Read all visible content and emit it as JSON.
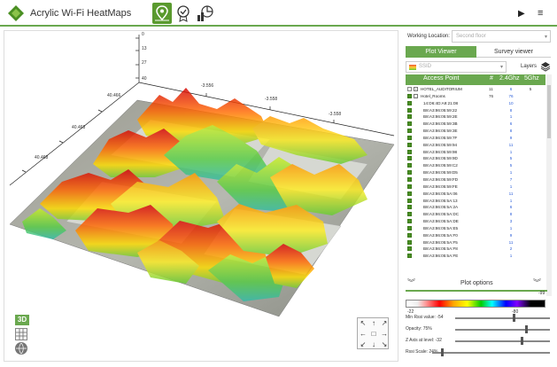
{
  "app": {
    "title": "Acrylic Wi-Fi HeatMaps"
  },
  "toolbar": {
    "modes": [
      "map-pin-icon",
      "badge-icon",
      "chart-icon"
    ],
    "play": "▶",
    "menu": "≡"
  },
  "axes": {
    "z_ticks": [
      "0",
      "13",
      "27",
      "40"
    ],
    "top_ticks": [
      "-3.556",
      "-3.558",
      "-3.558"
    ],
    "left_ticks": [
      "40.466",
      "40.468",
      "40.468"
    ]
  },
  "view_controls": {
    "btn3d": "3D"
  },
  "panel": {
    "working_location_label": "Working Location:",
    "working_location_value": "Second floor",
    "tabs": {
      "plot_viewer": "Plot Viewer",
      "survey_viewer": "Survey viewer"
    },
    "ssid_value": "SSID",
    "layers_label": "Layers",
    "table_headers": {
      "access_point": "Access Point",
      "count": "#",
      "ghz24": "2.4Ghz",
      "ghz5": "5Ghz"
    },
    "rows": [
      {
        "name": "HOTEL_AUDITORIUM",
        "count": "11",
        "ch24": "6",
        "ch5": "5",
        "checked": false,
        "group": true,
        "expander": "+"
      },
      {
        "name": "Hotel_Rooms",
        "count": "76",
        "ch24": "76",
        "ch5": "",
        "checked": true,
        "group": true,
        "expander": "-"
      },
      {
        "name": "14:D6:4D:A9:21:08",
        "count": "",
        "ch24": "10",
        "ch5": "",
        "checked": true
      },
      {
        "name": "B8:A3:86:05:59:22",
        "count": "",
        "ch24": "8",
        "ch5": "",
        "checked": true
      },
      {
        "name": "B8:A3:86:05:59:2E",
        "count": "",
        "ch24": "1",
        "ch5": "",
        "checked": true
      },
      {
        "name": "B8:A3:86:05:59:3B",
        "count": "",
        "ch24": "6",
        "ch5": "",
        "checked": true
      },
      {
        "name": "B8:A3:86:05:59:3E",
        "count": "",
        "ch24": "8",
        "ch5": "",
        "checked": true
      },
      {
        "name": "B8:A3:86:05:59:7F",
        "count": "",
        "ch24": "9",
        "ch5": "",
        "checked": true
      },
      {
        "name": "B8:A3:86:05:59:94",
        "count": "",
        "ch24": "11",
        "ch5": "",
        "checked": true
      },
      {
        "name": "B8:A3:86:05:59:98",
        "count": "",
        "ch24": "1",
        "ch5": "",
        "checked": true
      },
      {
        "name": "B8:A3:86:05:59:9D",
        "count": "",
        "ch24": "5",
        "ch5": "",
        "checked": true
      },
      {
        "name": "B8:A3:86:05:59:C2",
        "count": "",
        "ch24": "5",
        "ch5": "",
        "checked": true
      },
      {
        "name": "B8:A3:86:05:59:D5",
        "count": "",
        "ch24": "1",
        "ch5": "",
        "checked": true
      },
      {
        "name": "B8:A3:86:05:59:FD",
        "count": "",
        "ch24": "7",
        "ch5": "",
        "checked": true
      },
      {
        "name": "B8:A3:86:05:59:FE",
        "count": "",
        "ch24": "1",
        "ch5": "",
        "checked": true
      },
      {
        "name": "B8:A3:86:05:5A:06",
        "count": "",
        "ch24": "11",
        "ch5": "",
        "checked": true
      },
      {
        "name": "B8:A3:86:05:5A:13",
        "count": "",
        "ch24": "1",
        "ch5": "",
        "checked": true
      },
      {
        "name": "B8:A3:86:05:5A:2A",
        "count": "",
        "ch24": "6",
        "ch5": "",
        "checked": true
      },
      {
        "name": "B8:A3:86:05:5A:DC",
        "count": "",
        "ch24": "8",
        "ch5": "",
        "checked": true
      },
      {
        "name": "B8:A3:86:05:5A:DE",
        "count": "",
        "ch24": "3",
        "ch5": "",
        "checked": true
      },
      {
        "name": "B8:A3:86:05:5A:E5",
        "count": "",
        "ch24": "1",
        "ch5": "",
        "checked": true
      },
      {
        "name": "B8:A3:86:05:5A:F0",
        "count": "",
        "ch24": "9",
        "ch5": "",
        "checked": true
      },
      {
        "name": "B8:A3:86:05:5A:F5",
        "count": "",
        "ch24": "11",
        "ch5": "",
        "checked": true
      },
      {
        "name": "B8:A3:86:05:5A:F8",
        "count": "",
        "ch24": "2",
        "ch5": "",
        "checked": true
      },
      {
        "name": "B8:A3:86:05:5A:FE",
        "count": "",
        "ch24": "1",
        "ch5": "",
        "checked": true
      }
    ],
    "plot_options_label": "Plot options",
    "scale": {
      "top_right": "-99",
      "left_low": "-22",
      "right_low": "-80"
    },
    "sliders": [
      {
        "label": "Min Rssi value: -54",
        "value": 0.62
      },
      {
        "label": "Opacity: 75%",
        "value": 0.75
      },
      {
        "label": "Z Axis at level: -32",
        "value": 0.7
      },
      {
        "label": "Rssi Scale: 24%",
        "value": 0.08
      }
    ]
  },
  "colors": {
    "accent": "#6aa84f",
    "link_blue": "#2b5ed9"
  }
}
